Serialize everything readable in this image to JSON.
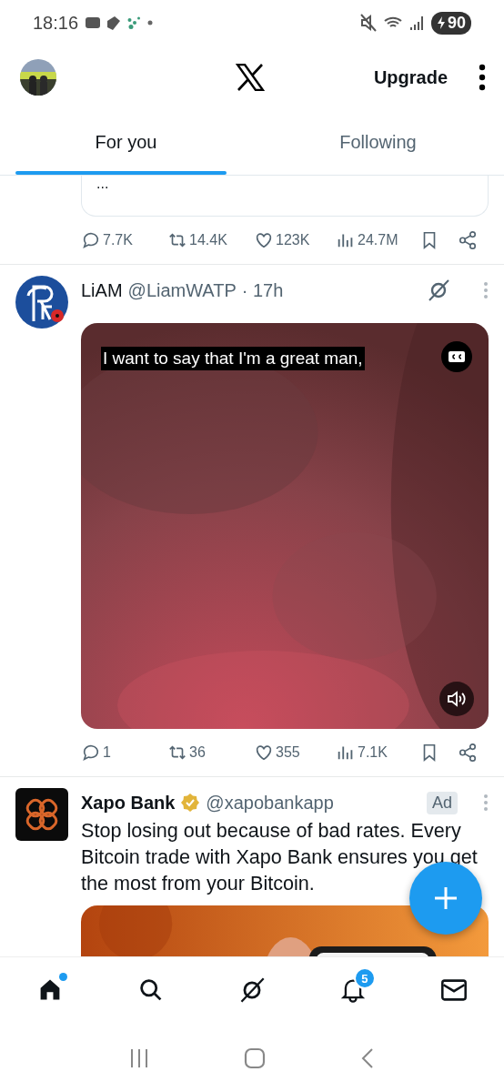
{
  "status_bar": {
    "time": "18:16",
    "battery": "90"
  },
  "header": {
    "upgrade": "Upgrade"
  },
  "tabs": [
    {
      "label": "For you",
      "selected": true
    },
    {
      "label": "Following",
      "selected": false
    }
  ],
  "posts": [
    {
      "kind": "cut",
      "quote_text": "...",
      "actions": [
        {
          "kind": "reply",
          "count": "7.7K"
        },
        {
          "kind": "repost",
          "count": "14.4K"
        },
        {
          "kind": "like",
          "count": "123K"
        },
        {
          "kind": "views",
          "count": "24.7M"
        },
        {
          "kind": "bookmark"
        },
        {
          "kind": "share"
        }
      ]
    },
    {
      "kind": "video",
      "name": "LiAM",
      "handle": "@LiamWATP",
      "time": "· 17h",
      "caption": "I want to say that I'm a great man,",
      "actions": [
        {
          "kind": "reply",
          "count": "1"
        },
        {
          "kind": "repost",
          "count": "36"
        },
        {
          "kind": "like",
          "count": "355"
        },
        {
          "kind": "views",
          "count": "7.1K"
        },
        {
          "kind": "bookmark"
        },
        {
          "kind": "share"
        }
      ]
    },
    {
      "kind": "ad",
      "name": "Xapo Bank",
      "verified": true,
      "handle": "@xapobankapp",
      "badge": "Ad",
      "text": "Stop losing out because of bad rates. Every Bitcoin trade with Xapo Bank ensures you get the most from your Bitcoin."
    }
  ],
  "nav": [
    {
      "kind": "home",
      "selected": true,
      "unread": true
    },
    {
      "kind": "search",
      "selected": false,
      "unread": false
    },
    {
      "kind": "grok",
      "selected": false,
      "unread": false
    },
    {
      "kind": "bell",
      "selected": false,
      "unread": false,
      "badge": "5"
    },
    {
      "kind": "mail",
      "selected": false,
      "unread": false
    }
  ]
}
